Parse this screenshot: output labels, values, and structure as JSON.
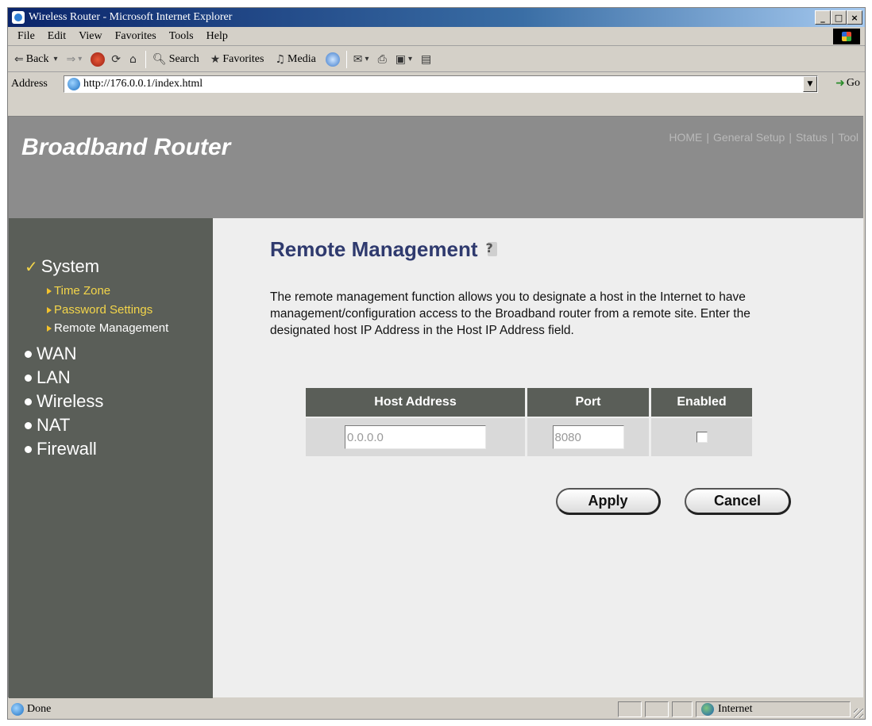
{
  "window": {
    "title": "Wireless Router - Microsoft Internet Explorer",
    "controls": [
      "_",
      "□",
      "×"
    ]
  },
  "menu": [
    "File",
    "Edit",
    "View",
    "Favorites",
    "Tools",
    "Help"
  ],
  "toolbar": {
    "back": "Back",
    "search": "Search",
    "favorites": "Favorites",
    "media": "Media"
  },
  "address": {
    "label": "Address",
    "url": "http://176.0.0.1/index.html",
    "go": "Go"
  },
  "router": {
    "brand": "Broadband Router",
    "topnav": [
      "HOME",
      "General Setup",
      "Status",
      "Tool"
    ]
  },
  "sidebar": {
    "system": "System",
    "sub": [
      "Time Zone",
      "Password Settings",
      "Remote Management"
    ],
    "categories": [
      "WAN",
      "LAN",
      "Wireless",
      "NAT",
      "Firewall"
    ]
  },
  "main": {
    "title": "Remote Management",
    "description": "The remote management function allows you to designate a host in the Internet to have management/configuration access to the Broadband router from a remote site. Enter the designated host IP Address in the Host IP Address field.",
    "table": {
      "headers": [
        "Host Address",
        "Port",
        "Enabled"
      ],
      "host_value": "0.0.0.0",
      "port_value": "8080",
      "enabled": false
    },
    "apply": "Apply",
    "cancel": "Cancel"
  },
  "status": {
    "text": "Done",
    "zone": "Internet"
  },
  "colors": {
    "sidebar": "#5a5e58",
    "header": "#8c8c8c",
    "title": "#2f3a6e",
    "submenu_active": "#f3d54a"
  }
}
